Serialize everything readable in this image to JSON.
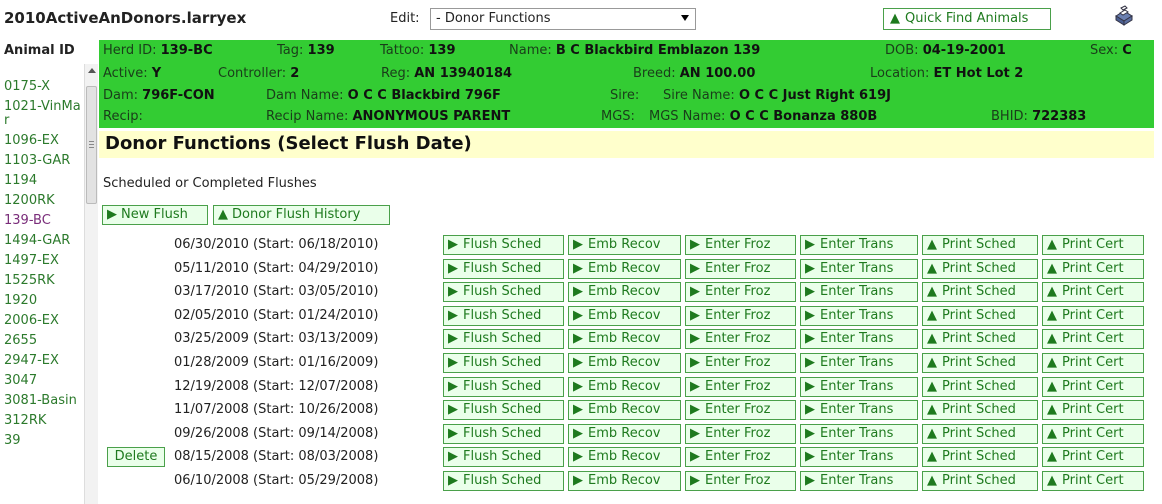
{
  "window": {
    "title": "2010ActiveAnDonors.larryex"
  },
  "toolbar": {
    "edit_label": "Edit:",
    "edit_selected": "- Donor Functions",
    "quick_find_label": "Quick Find Animals",
    "print_icon": "printer-icon"
  },
  "sidebar": {
    "header": "Animal ID",
    "items": [
      {
        "label": "0175-X",
        "selected": false
      },
      {
        "label": "1021-VinMar",
        "selected": false
      },
      {
        "label": "1096-EX",
        "selected": false
      },
      {
        "label": "1103-GAR",
        "selected": false
      },
      {
        "label": "1194",
        "selected": false
      },
      {
        "label": "1200RK",
        "selected": false
      },
      {
        "label": "139-BC",
        "selected": true
      },
      {
        "label": "1494-GAR",
        "selected": false
      },
      {
        "label": "1497-EX",
        "selected": false
      },
      {
        "label": "1525RK",
        "selected": false
      },
      {
        "label": "1920",
        "selected": false
      },
      {
        "label": "2006-EX",
        "selected": false
      },
      {
        "label": "2655",
        "selected": false
      },
      {
        "label": "2947-EX",
        "selected": false
      },
      {
        "label": "3047",
        "selected": false
      },
      {
        "label": "3081-Basin",
        "selected": false
      },
      {
        "label": "312RK",
        "selected": false
      },
      {
        "label": "39",
        "selected": false
      }
    ]
  },
  "animal": {
    "herd_id_label": "Herd ID:",
    "herd_id": "139-BC",
    "tag_label": "Tag:",
    "tag": "139",
    "tattoo_label": "Tattoo:",
    "tattoo": "139",
    "name_label": "Name:",
    "name": "B C Blackbird Emblazon 139",
    "dob_label": "DOB:",
    "dob": "04-19-2001",
    "sex_label": "Sex:",
    "sex": "C",
    "active_label": "Active:",
    "active": "Y",
    "controller_label": "Controller:",
    "controller": "2",
    "reg_label": "Reg:",
    "reg": "AN 13940184",
    "breed_label": "Breed:",
    "breed": "AN 100.00",
    "location_label": "Location:",
    "location": "ET Hot Lot 2",
    "dam_label": "Dam:",
    "dam": "796F-CON",
    "dam_name_label": "Dam Name:",
    "dam_name": "O C C Blackbird 796F",
    "sire_label": "Sire:",
    "sire": "",
    "sire_name_label": "Sire Name:",
    "sire_name": "O C C Just Right 619J",
    "recip_label": "Recip:",
    "recip": "",
    "recip_name_label": "Recip Name:",
    "recip_name": "ANONYMOUS PARENT",
    "mgs_label": "MGS:",
    "mgs": "",
    "mgs_name_label": "MGS Name:",
    "mgs_name": "O C C Bonanza 880B",
    "bhid_label": "BHID:",
    "bhid": "722383"
  },
  "main": {
    "section_title": "Donor Functions (Select Flush Date)",
    "flushes_label": "Scheduled or Completed Flushes",
    "new_flush_label": "New Flush",
    "donor_history_label": "Donor Flush History",
    "delete_label": "Delete",
    "actions": {
      "flush_sched": "Flush Sched",
      "emb_recov": "Emb Recov",
      "enter_froz": "Enter Froz",
      "enter_trans": "Enter Trans",
      "print_sched": "Print Sched",
      "print_cert": "Print Cert"
    },
    "flushes": [
      {
        "date": "06/30/2010 (Start: 06/18/2010)",
        "deletable": false
      },
      {
        "date": "05/11/2010 (Start: 04/29/2010)",
        "deletable": false
      },
      {
        "date": "03/17/2010 (Start: 03/05/2010)",
        "deletable": false
      },
      {
        "date": "02/05/2010 (Start: 01/24/2010)",
        "deletable": false
      },
      {
        "date": "03/25/2009 (Start: 03/13/2009)",
        "deletable": false
      },
      {
        "date": "01/28/2009 (Start: 01/16/2009)",
        "deletable": false
      },
      {
        "date": "12/19/2008 (Start: 12/07/2008)",
        "deletable": false
      },
      {
        "date": "11/07/2008 (Start: 10/26/2008)",
        "deletable": false
      },
      {
        "date": "09/26/2008 (Start: 09/14/2008)",
        "deletable": false
      },
      {
        "date": "08/15/2008 (Start: 08/03/2008)",
        "deletable": true
      },
      {
        "date": "06/10/2008 (Start: 05/29/2008)",
        "deletable": false
      }
    ]
  },
  "colors": {
    "info_panel_bg": "#33cc33",
    "section_header_bg": "#ffffcc",
    "link_green": "#2c7a2c",
    "selected_item": "#7a2c7a"
  }
}
